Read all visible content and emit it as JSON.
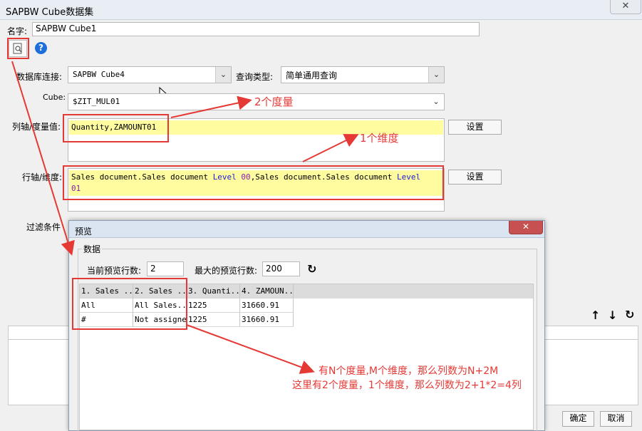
{
  "window": {
    "title": "SAPBW Cube数据集",
    "close": "✕"
  },
  "name": {
    "label": "名字:",
    "value": "SAPBW Cube1"
  },
  "toolbar": {
    "preview_icon": "preview-icon",
    "help_icon": "help-icon",
    "help_glyph": "?"
  },
  "db_connection": {
    "label": "数据库连接:",
    "value": "SAPBW Cube4"
  },
  "query_type": {
    "label": "查询类型:",
    "value": "简单通用查询"
  },
  "cube": {
    "label": "Cube:",
    "value": "$ZIT_MUL01"
  },
  "column_axis": {
    "label": "列轴/度量值:",
    "value": "Quantity,ZAMOUNT01",
    "button": "设置"
  },
  "row_axis": {
    "label": "行轴/维度:",
    "line1_a": "Sales document.Sales document ",
    "line1_b": "Level",
    "line1_c": " 00",
    "line1_d": ",Sales document.Sales document ",
    "line1_e": "Level",
    "line2": "01",
    "button": "设置"
  },
  "filter": {
    "label": "过滤条件"
  },
  "annotations": {
    "measures": "2个度量",
    "dimension": "1个维度",
    "formula_line1": "有N个度量,M个维度，那么列数为N+2M",
    "formula_line2": "这里有2个度量，1个维度，那么列数为2+1*2=4列"
  },
  "right_toolbar": {
    "up": "↑",
    "down": "↓",
    "refresh": "↻"
  },
  "footer": {
    "ok": "确定",
    "cancel": "取消"
  },
  "preview": {
    "title": "预览",
    "close": "✕",
    "group": "数据",
    "current_rows_label": "当前预览行数:",
    "current_rows": "2",
    "max_rows_label": "最大的预览行数:",
    "max_rows": "200",
    "refresh": "↻",
    "columns": [
      "1. Sales ...",
      "2. Sales ...",
      "3. Quanti...",
      "4. ZAMOUN..."
    ],
    "rows": [
      [
        "All",
        "All Sales...",
        "1225",
        "31660.91"
      ],
      [
        "#",
        "Not assigned",
        "1225",
        "31660.91"
      ]
    ]
  }
}
